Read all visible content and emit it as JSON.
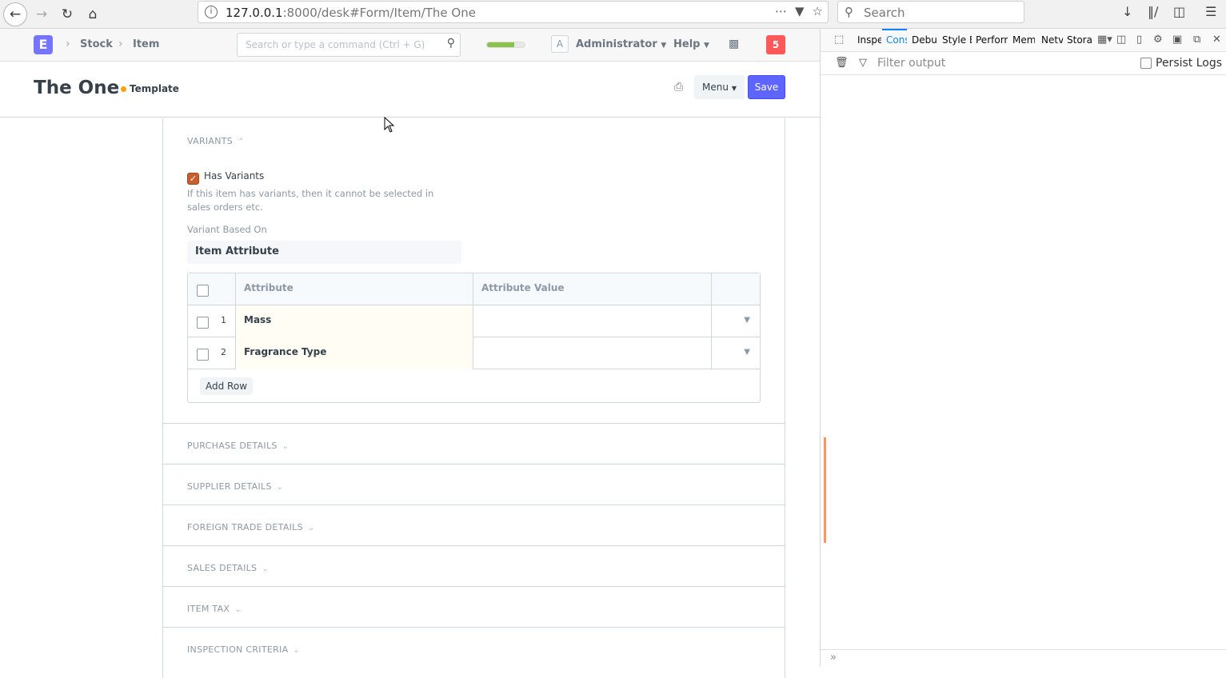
{
  "browser": {
    "url_host": "127.0.0.1",
    "url_rest": ":8000/desk#Form/Item/The One",
    "search_placeholder": "Search"
  },
  "navbar": {
    "logo_letter": "E",
    "breadcrumbs": [
      "Stock",
      "Item"
    ],
    "command_placeholder": "Search or type a command (Ctrl + G)",
    "progress_fraction": 0.72,
    "avatar_letter": "A",
    "user_label": "Administrator",
    "help_label": "Help",
    "notification_count": "5"
  },
  "page": {
    "title": "The One",
    "indicator": "Template",
    "menu_label": "Menu",
    "save_label": "Save"
  },
  "variants": {
    "section_label": "VARIANTS",
    "has_variants_label": "Has Variants",
    "has_variants_help": "If this item has variants, then it cannot be selected in sales orders etc.",
    "variant_based_on_label": "Variant Based On",
    "variant_based_on_value": "Item Attribute",
    "grid": {
      "columns": [
        "Attribute",
        "Attribute Value"
      ],
      "rows": [
        {
          "idx": "1",
          "attribute": "Mass",
          "value": ""
        },
        {
          "idx": "2",
          "attribute": "Fragrance Type",
          "value": ""
        }
      ],
      "add_row_label": "Add Row"
    }
  },
  "sections": [
    "PURCHASE DETAILS",
    "SUPPLIER DETAILS",
    "FOREIGN TRADE DETAILS",
    "SALES DETAILS",
    "ITEM TAX",
    "INSPECTION CRITERIA"
  ],
  "devtools": {
    "tabs": [
      "Inspe",
      "Cons",
      "Debu",
      "Style E",
      "Perforr",
      "Mem",
      "Netv",
      "Stora"
    ],
    "active_tab": "Cons",
    "filter_placeholder": "Filter output",
    "persist_logs_label": "Persist Logs"
  },
  "colors": {
    "brand": "#7574ff",
    "primary_button": "#5e64ff",
    "notification": "#ff5858",
    "indicator_orange": "#ffa00a",
    "checkbox_checked": "#c95f2d",
    "devtools_active": "#0a84ff"
  }
}
